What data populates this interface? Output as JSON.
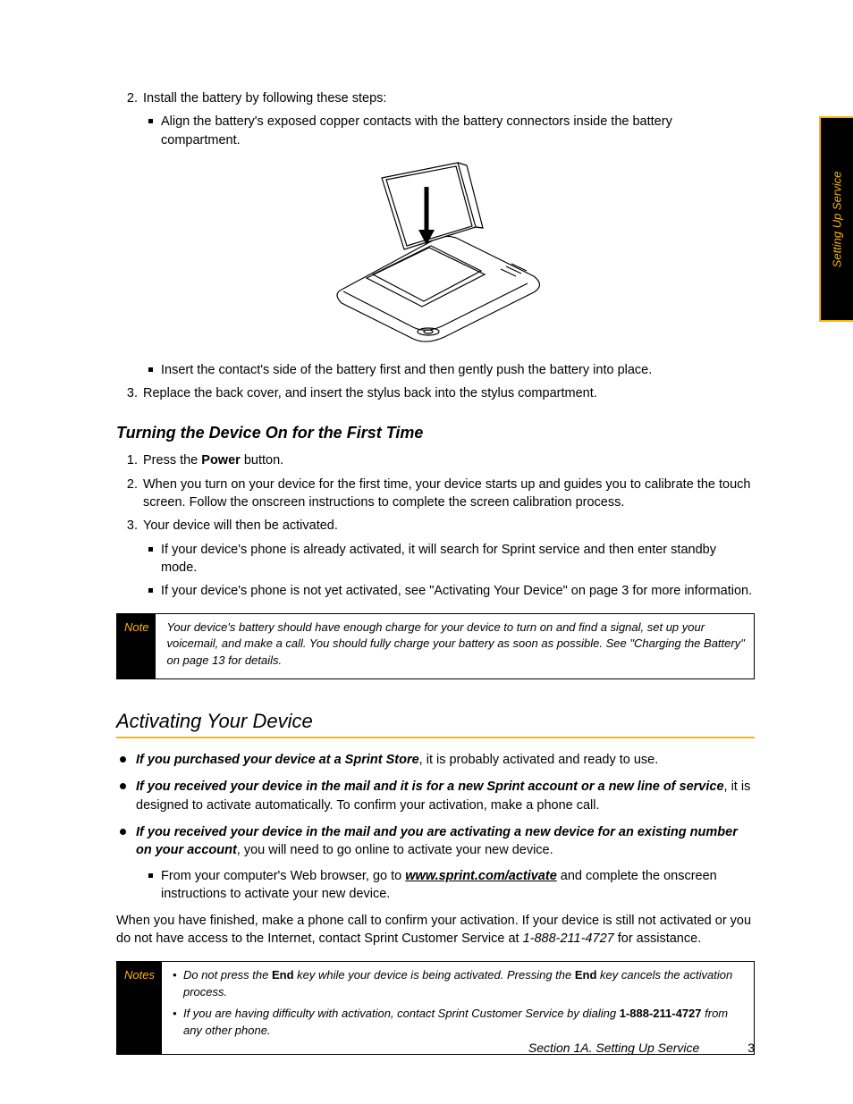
{
  "side_tab": "Setting Up Service",
  "step2": {
    "num": "2.",
    "text": "Install the battery by following these steps:",
    "bullet_a": "Align the battery's exposed copper contacts with the battery connectors inside the battery compartment.",
    "bullet_b": "Insert the contact's side of the battery first and then gently push the battery into place."
  },
  "step3": {
    "num": "3.",
    "text": "Replace the back cover, and insert the stylus back into the stylus compartment."
  },
  "h3_turn_on": "Turning the Device On for the First Time",
  "t1": {
    "num": "1.",
    "pre": "Press the ",
    "bold": "Power",
    "post": " button."
  },
  "t2": {
    "num": "2.",
    "text": "When you turn on your device for the first time, your device starts up and guides you to calibrate the touch screen. Follow the onscreen instructions to complete the screen calibration process."
  },
  "t3": {
    "num": "3.",
    "text": "Your device will then be activated.",
    "sub_a": "If your device's phone is already activated, it will search for Sprint service and then enter standby mode.",
    "sub_b": "If your device's phone is not yet activated, see \"Activating Your Device\" on page 3 for more information."
  },
  "note1": {
    "label": "Note",
    "text": "Your device's battery should have enough charge for your device to turn on and find a signal, set up your voicemail, and make a call. You should fully charge your battery as soon as possible. See \"Charging the Battery\" on page 13 for details."
  },
  "h2_activating": "Activating Your Device",
  "act1": {
    "bi": "If you purchased your device at a Sprint Store",
    "rest": ", it is probably activated and ready to use."
  },
  "act2": {
    "bi": "If you received your device in the mail and it is for a new Sprint account or a new line of service",
    "rest": ", it is designed to activate automatically. To confirm your activation, make a phone call."
  },
  "act3": {
    "bi": "If you received your device in the mail and you are activating a new device for an existing number on your account",
    "rest": ", you will need to go online to activate your new device.",
    "sub_pre": "From your computer's Web browser, go to ",
    "sub_link": "www.sprint.com/activate",
    "sub_post": " and complete the onscreen instructions to activate your new device."
  },
  "finished": {
    "pre": "When you have finished, make a phone call to confirm your activation. If your device is still not activated or you do not have access to the Internet, contact Sprint Customer Service at ",
    "phone": "1-888-211-4727",
    "post": " for assistance."
  },
  "notes2": {
    "label": "Notes",
    "a_pre": "Do not press the ",
    "a_b1": "End",
    "a_mid": " key while your device is being activated. Pressing the ",
    "a_b2": "End",
    "a_post": " key cancels the activation process.",
    "b_pre": "If you are having difficulty with activation, contact Sprint Customer Service by dialing ",
    "b_phone": "1-888-211-4727",
    "b_post": " from any other phone."
  },
  "footer": {
    "section": "Section 1A. Setting Up Service",
    "page": "3"
  }
}
